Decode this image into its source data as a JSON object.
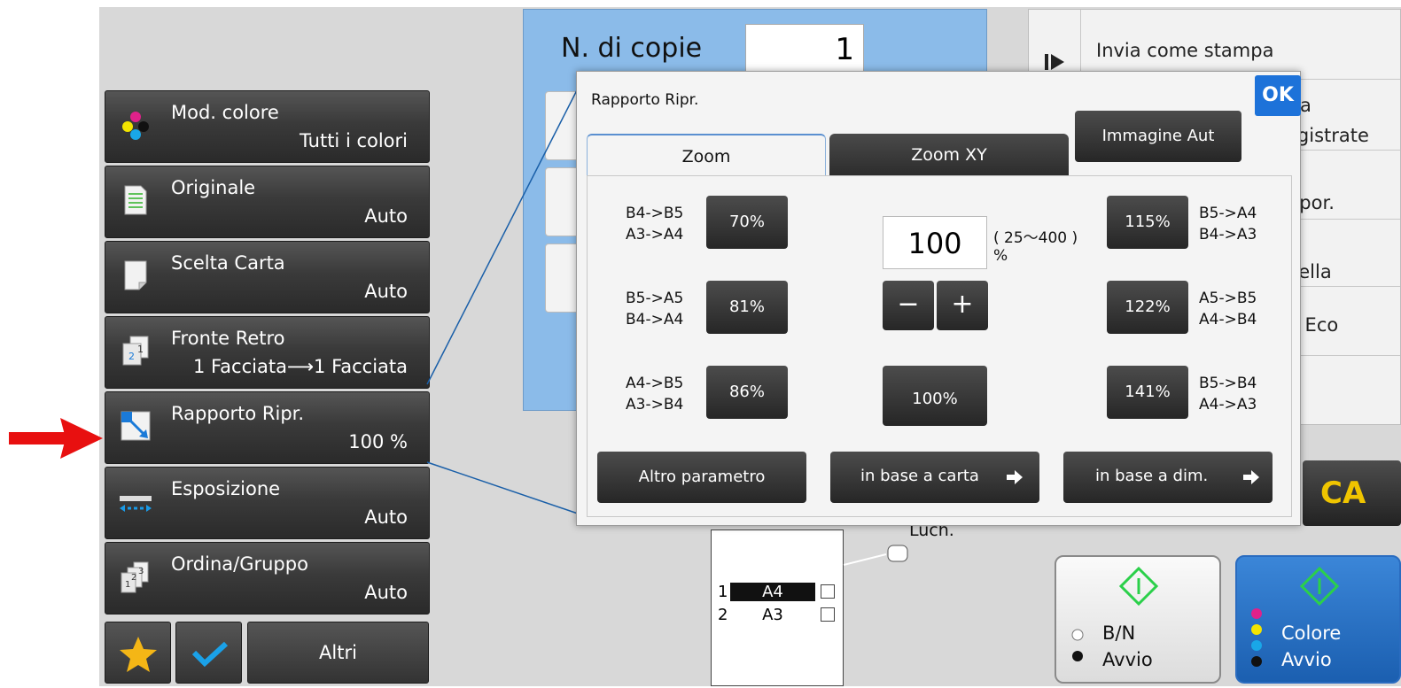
{
  "left_menu": [
    {
      "label": "Mod. colore",
      "value": "Tutti i colori",
      "icon": "color-mode-icon"
    },
    {
      "label": "Originale",
      "value": "Auto",
      "icon": "original-document-icon"
    },
    {
      "label": "Scelta Carta",
      "value": "Auto",
      "icon": "paper-select-icon"
    },
    {
      "label": "Fronte Retro",
      "value": "1 Facciata⟶1 Facciata",
      "icon": "duplex-icon"
    },
    {
      "label": "Rapporto Ripr.",
      "value": "100 %",
      "icon": "zoom-ratio-icon"
    },
    {
      "label": "Esposizione",
      "value": "Auto",
      "icon": "exposure-icon"
    },
    {
      "label": "Ordina/Gruppo",
      "value": "Auto",
      "icon": "sort-group-icon"
    }
  ],
  "bottom_bar": {
    "altri_label": "Altri"
  },
  "copies": {
    "label": "N. di copie",
    "value": "1"
  },
  "right_panel": {
    "send_as_print": "Invia come stampa",
    "partial_items": [
      "a",
      "egistrate",
      "npor.",
      "tella",
      "a Eco"
    ]
  },
  "ca_label": "CA",
  "start_bw": {
    "line1": "B/N",
    "line2": "Avvio"
  },
  "start_color": {
    "line1": "Colore",
    "line2": "Avvio"
  },
  "trays": [
    {
      "num": "1",
      "size": "A4"
    },
    {
      "num": "2",
      "size": "A3"
    }
  ],
  "partial_text": "Luch.",
  "dialog": {
    "title": "Rapporto Ripr.",
    "ok_label": "OK",
    "tabs": [
      "Zoom",
      "Zoom XY"
    ],
    "auto_image_label": "Immagine Aut",
    "zoom_value": "100",
    "range_text": "( 25～400 )",
    "percent_sign": "%",
    "minus_label": "−",
    "plus_label": "+",
    "preset_100": "100%",
    "left_presets": [
      {
        "sizes": "B4->B5\nA3->A4",
        "label": "70%"
      },
      {
        "sizes": "B5->A5\nB4->A4",
        "label": "81%"
      },
      {
        "sizes": "A4->B5\nA3->B4",
        "label": "86%"
      }
    ],
    "right_presets": [
      {
        "sizes": "B5->A4\nB4->A3",
        "label": "115%"
      },
      {
        "sizes": "A5->B5\nA4->B4",
        "label": "122%"
      },
      {
        "sizes": "B5->B4\nA4->A3",
        "label": "141%"
      }
    ],
    "bottom_buttons": [
      "Altro parametro",
      "in base a carta",
      "in base a dim."
    ]
  },
  "colors": {
    "accent_blue": "#1d72d9",
    "copies_panel": "#8bbbe9",
    "ca_text": "#f0c500",
    "start_icon_green": "#2bd04a",
    "pointer_red": "#e81010"
  }
}
